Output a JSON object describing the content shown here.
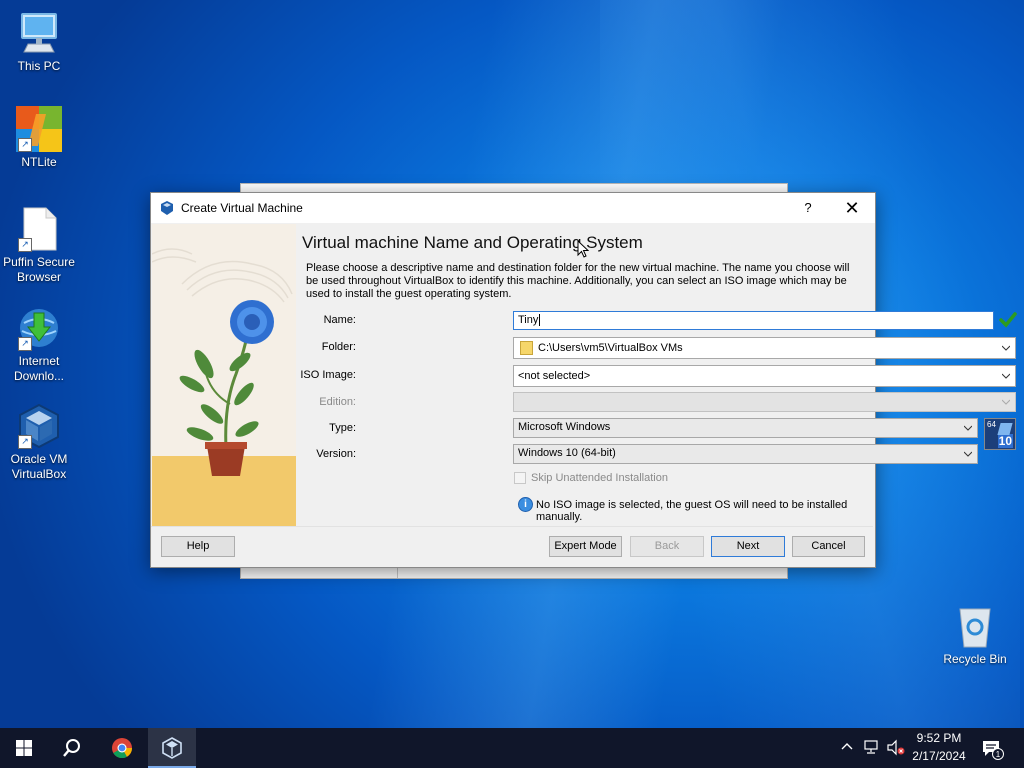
{
  "desktop": {
    "icons": [
      {
        "label": "This PC"
      },
      {
        "label": "NTLite"
      },
      {
        "label": "Puffin Secure Browser"
      },
      {
        "label": "Internet Downlo..."
      },
      {
        "label": "Oracle VM VirtualBox"
      },
      {
        "label": "Recycle Bin"
      }
    ]
  },
  "dialog": {
    "title": "Create Virtual Machine",
    "help_glyph": "?",
    "close_glyph": "✕",
    "heading": "Virtual machine Name and Operating System",
    "description": "Please choose a descriptive name and destination folder for the new virtual machine. The name you choose will be used throughout VirtualBox to identify this machine. Additionally, you can select an ISO image which may be used to install the guest operating system.",
    "fields": {
      "name_label": "Name:",
      "name_value": "Tiny",
      "folder_label": "Folder:",
      "folder_value": "C:\\Users\\vm5\\VirtualBox VMs",
      "iso_label": "ISO Image:",
      "iso_value": "<not selected>",
      "edition_label": "Edition:",
      "edition_value": "",
      "type_label": "Type:",
      "type_value": "Microsoft Windows",
      "version_label": "Version:",
      "version_value": "Windows 10 (64-bit)"
    },
    "os_badge": {
      "bits": "64",
      "version": "10"
    },
    "skip_unattended_label": "Skip Unattended Installation",
    "skip_unattended_checked": false,
    "info_message": "No ISO image is selected, the guest OS will need to be installed manually.",
    "buttons": {
      "help": "Help",
      "expert_mode": "Expert Mode",
      "back": "Back",
      "next": "Next",
      "cancel": "Cancel"
    }
  },
  "taskbar": {
    "clock_time": "9:52 PM",
    "clock_date": "2/17/2024",
    "notification_count": "1"
  },
  "colors": {
    "accent": "#2f7bd8",
    "valid_check": "#2e9b1e",
    "taskbar": "#10162a"
  }
}
